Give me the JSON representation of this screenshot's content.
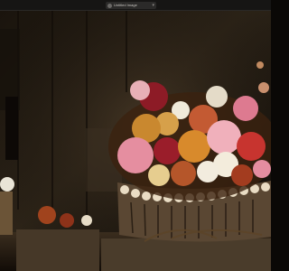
{
  "window": {
    "title": "Untitled Image",
    "dropdown_icon": "chevron-down-icon"
  },
  "image": {
    "description": "Still life photograph",
    "colors": {
      "background": "#0a0806",
      "wood": "#4a3a26",
      "pink": "#e58ea0",
      "red": "#9a1d2a",
      "orange": "#c97a2a",
      "cream": "#f1e6cf"
    }
  }
}
